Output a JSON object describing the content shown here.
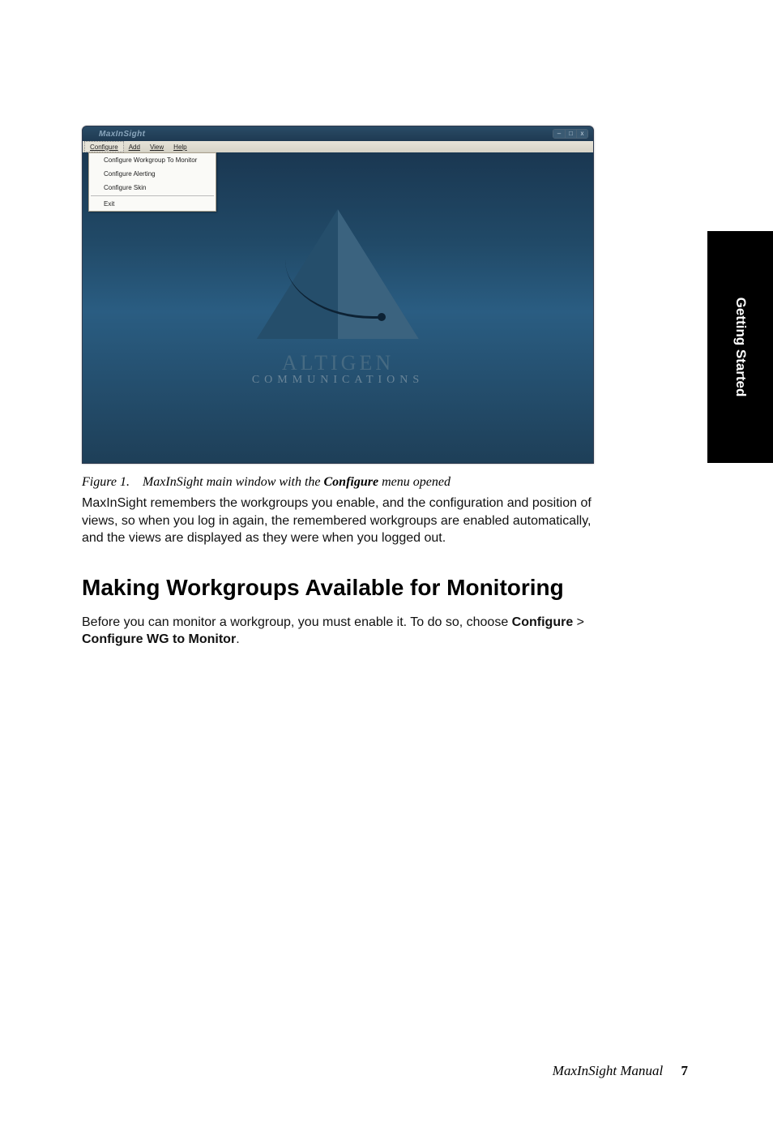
{
  "sideTab": "Getting Started",
  "app": {
    "title": "MaxInSight",
    "menus": [
      "Configure",
      "Add",
      "View",
      "Help"
    ],
    "dropdown": [
      "Configure Workgroup To Monitor",
      "Configure Alerting",
      "Configure Skin",
      "Exit"
    ],
    "windowControls": {
      "min": "–",
      "max": "□",
      "close": "x"
    },
    "logo": {
      "line1": "ALTIGEN",
      "line2": "COMMUNICATIONS"
    }
  },
  "caption": {
    "label": "Figure 1.",
    "pre": "MaxInSight main window with the ",
    "bold": "Configure",
    "post": " menu opened"
  },
  "para1": "MaxInSight remembers the workgroups you enable, and the configuration and position of views, so when you log in again, the remembered workgroups are enabled automatically, and the views are displayed as they were when you logged out.",
  "heading": "Making Workgroups Available for Monitoring",
  "para2": {
    "pre": "Before you can monitor a workgroup, you must enable it. To do so, choose ",
    "b1": "Configure",
    "sep": " > ",
    "b2": "Configure WG to Monitor",
    "post": "."
  },
  "footer": {
    "title": "MaxInSight Manual",
    "page": "7"
  }
}
